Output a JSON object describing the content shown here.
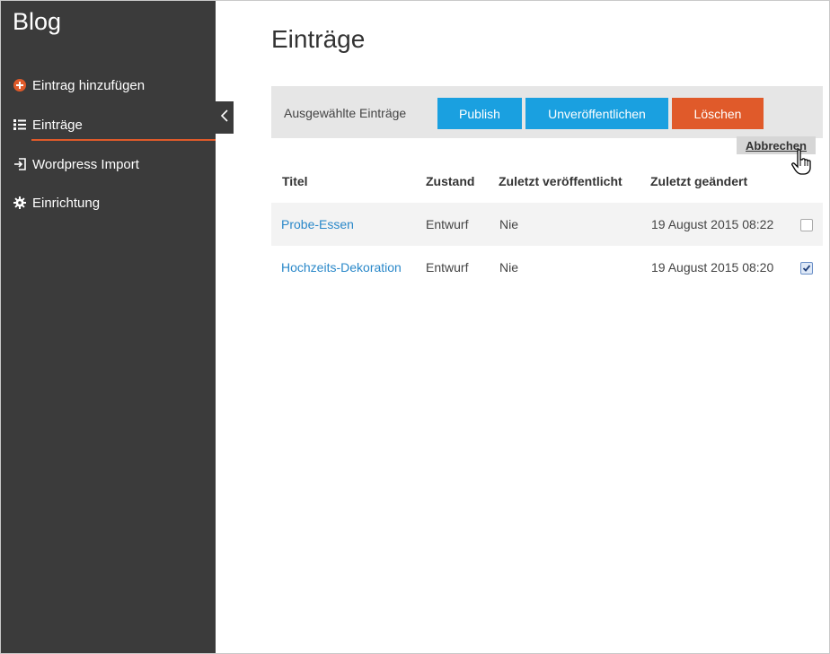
{
  "sidebar": {
    "brand": "Blog",
    "items": [
      {
        "label": "Eintrag hinzufügen",
        "icon": "plus-circle-icon"
      },
      {
        "label": "Einträge",
        "icon": "list-icon"
      },
      {
        "label": "Wordpress Import",
        "icon": "import-icon"
      },
      {
        "label": "Einrichtung",
        "icon": "gear-icon"
      }
    ],
    "active_index": 1
  },
  "main": {
    "title": "Einträge",
    "toolbar": {
      "label": "Ausgewählte Einträge",
      "publish": "Publish",
      "unpublish": "Unveröffentlichen",
      "delete": "Löschen",
      "cancel": "Abbrechen"
    },
    "table": {
      "headers": [
        "Titel",
        "Zustand",
        "Zuletzt veröffentlicht",
        "Zuletzt geändert"
      ],
      "rows": [
        {
          "title": "Probe-Essen",
          "status": "Entwurf",
          "published": "Nie",
          "modified": "19 August 2015 08:22",
          "checked": false
        },
        {
          "title": "Hochzeits-Dekoration",
          "status": "Entwurf",
          "published": "Nie",
          "modified": "19 August 2015 08:20",
          "checked": true
        }
      ]
    }
  },
  "colors": {
    "sidebar_bg": "#3b3b3b",
    "accent_blue": "#1aa0e0",
    "accent_orange": "#e05a2a",
    "link": "#2a88c9"
  }
}
